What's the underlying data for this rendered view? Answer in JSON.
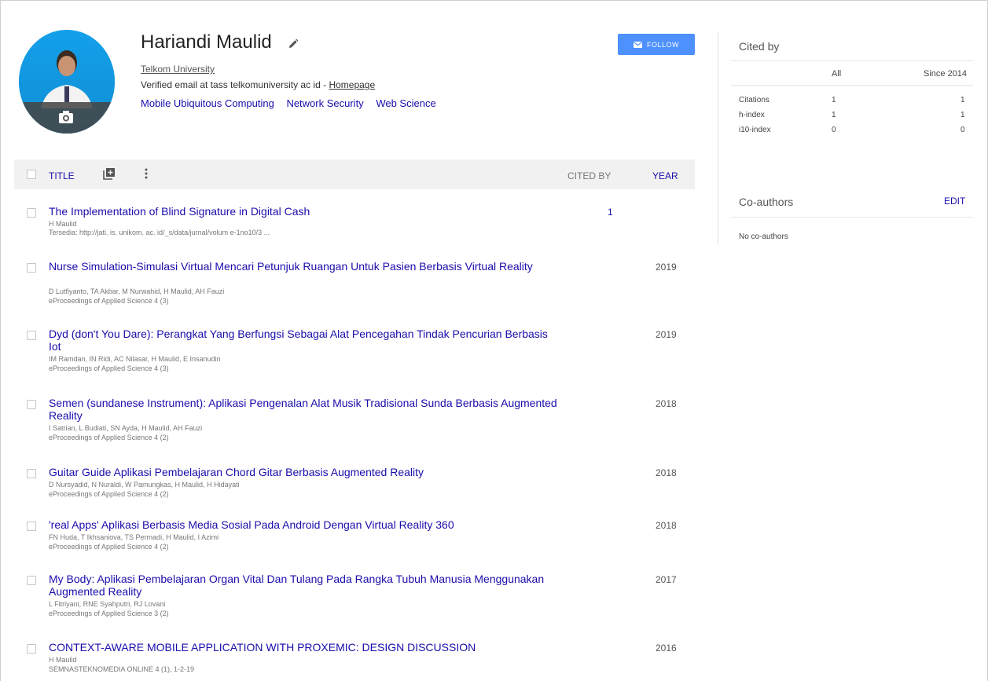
{
  "profile": {
    "name": "Hariandi Maulid",
    "affiliation": "Telkom University",
    "email_text": "Verified email at tass telkomuniversity ac id - ",
    "homepage_label": "Homepage",
    "topics": [
      "Mobile Ubiquitous Computing",
      "Network Security",
      "Web Science"
    ],
    "follow_label": "FOLLOW"
  },
  "table": {
    "header": {
      "title": "TITLE",
      "cited_by": "CITED BY",
      "year": "YEAR"
    },
    "rows": [
      {
        "title": "The Implementation of Blind Signature in Digital Cash",
        "authors": "H Maulid",
        "venue": "Tersedia: http://jati. is. unikom. ac. id/_s/data/jurnal/volum e-1no10/3 ...",
        "cited": "1",
        "year": ""
      },
      {
        "title": "Nurse Simulation-Simulasi Virtual Mencari Petunjuk Ruangan Untuk Pasien Berbasis Virtual Reality",
        "authors": "D Lutfiyanto, TA Akbar, M Nurwahid, H Maulid, AH Fauzi",
        "venue": "eProceedings of Applied Science 4 (3)",
        "cited": "",
        "year": "2019"
      },
      {
        "title": "Dyd (don't You Dare): Perangkat Yang Berfungsi Sebagai Alat Pencegahan Tindak Pencurian Berbasis Iot",
        "authors": "IM Ramdan, IN Ridi, AC Nilasar, H Maulid, E Insanudin",
        "venue": "eProceedings of Applied Science 4 (3)",
        "cited": "",
        "year": "2019"
      },
      {
        "title": "Semen (sundanese Instrument): Aplikasi Pengenalan Alat Musik Tradisional Sunda Berbasis Augmented Reality",
        "authors": "I Satrian, L Budiati, SN Ayda, H Maulid, AH Fauzi",
        "venue": "eProceedings of Applied Science 4 (2)",
        "cited": "",
        "year": "2018"
      },
      {
        "title": "Guitar Guide Aplikasi Pembelajaran Chord Gitar Berbasis Augmented Reality",
        "authors": "D Nursyadid, N Nuraldi, W Pamungkas, H Maulid, H Hidayati",
        "venue": "eProceedings of Applied Science 4 (2)",
        "cited": "",
        "year": "2018"
      },
      {
        "title": "'real Apps' Aplikasi Berbasis Media Sosial Pada Android Dengan Virtual Reality 360",
        "authors": "FN Huda, T Ikhsaniova, TS Permadi, H Maulid, I Azimi",
        "venue": "eProceedings of Applied Science 4 (2)",
        "cited": "",
        "year": "2018"
      },
      {
        "title": "My Body: Aplikasi Pembelajaran Organ Vital Dan Tulang Pada Rangka Tubuh Manusia Menggunakan Augmented Reality",
        "authors": "L Fitriyani, RNE Syahputri, RJ Lovani",
        "venue": "eProceedings of Applied Science 3 (2)",
        "cited": "",
        "year": "2017"
      },
      {
        "title": "CONTEXT-AWARE MOBILE APPLICATION WITH PROXEMIC: DESIGN DISCUSSION",
        "authors": "H Maulid",
        "venue": "SEMNASTEKNOMEDIA ONLINE 4 (1), 1-2-19",
        "cited": "",
        "year": "2016"
      }
    ]
  },
  "cited_by": {
    "title": "Cited by",
    "col_all": "All",
    "col_since": "Since 2014",
    "rows": [
      {
        "label": "Citations",
        "all": "1",
        "since": "1"
      },
      {
        "label": "h-index",
        "all": "1",
        "since": "1"
      },
      {
        "label": "i10-index",
        "all": "0",
        "since": "0"
      }
    ]
  },
  "coauthors": {
    "title": "Co-authors",
    "edit_label": "EDIT",
    "empty_text": "No co-authors"
  },
  "colors": {
    "link": "#1a0dab",
    "follow_button": "#4d90fe",
    "avatar_bg": "#14a0ea"
  }
}
